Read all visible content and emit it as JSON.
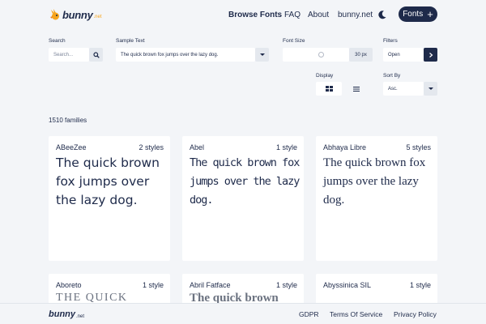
{
  "header": {
    "logo_text": "bunny",
    "logo_suffix": ".net",
    "nav": [
      "Browse Fonts",
      "FAQ",
      "About",
      "bunny.net"
    ],
    "fonts_button": "Fonts",
    "theme_icon": "moon-icon"
  },
  "filters": {
    "search": {
      "label": "Search",
      "placeholder": "Search..."
    },
    "sample_text": {
      "label": "Sample Text",
      "value": "The quick brown fox jumps over the lazy dog."
    },
    "font_size": {
      "label": "Font Size",
      "value": "30 px"
    },
    "filters": {
      "label": "Filters",
      "value": "Open"
    },
    "display": {
      "label": "Display"
    },
    "sort_by": {
      "label": "Sort By",
      "value": "Asc."
    }
  },
  "families_count": "1510 families",
  "cards": [
    {
      "name": "ABeeZee",
      "styles": "2 styles",
      "sample": "The quick brown fox jumps over the lazy dog."
    },
    {
      "name": "Abel",
      "styles": "1 style",
      "sample": "The quick brown fox jumps over the lazy dog."
    },
    {
      "name": "Abhaya Libre",
      "styles": "5 styles",
      "sample": "The quick brown fox jumps over the lazy dog."
    },
    {
      "name": "Aboreto",
      "styles": "1 style",
      "sample": "THE QUICK"
    },
    {
      "name": "Abril Fatface",
      "styles": "1 style",
      "sample": "The quick brown"
    },
    {
      "name": "Abyssinica SIL",
      "styles": "1 style",
      "sample": ""
    }
  ],
  "footer": {
    "logo_text": "bunny",
    "logo_suffix": ".net",
    "links": [
      "GDPR",
      "Terms Of Service",
      "Privacy Policy"
    ]
  },
  "colors": {
    "primary": "#1e2a4a",
    "accent": "#f7a51c",
    "background": "#f3f5f8"
  }
}
